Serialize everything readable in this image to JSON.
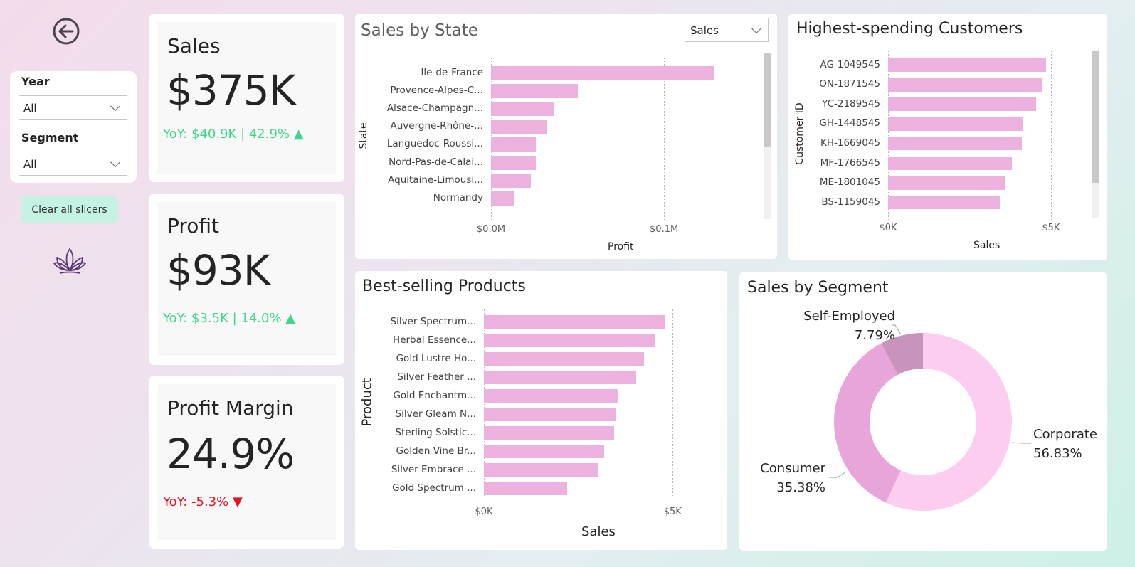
{
  "nav": {
    "back_icon": "back-arrow-icon",
    "logo_icon": "lotus-logo-icon"
  },
  "slicers": {
    "year": {
      "label": "Year",
      "value": "All"
    },
    "segment": {
      "label": "Segment",
      "value": "All"
    },
    "clear_label": "Clear all slicers"
  },
  "kpis": {
    "sales": {
      "title": "Sales",
      "value": "$375K",
      "yoy": "YoY: $40.9K | 42.9% ▲",
      "yoy_color": "#3dd68c"
    },
    "profit": {
      "title": "Profit",
      "value": "$93K",
      "yoy": "YoY: $3.5K | 14.0% ▲",
      "yoy_color": "#3dd68c"
    },
    "margin": {
      "title": "Profit Margin",
      "value": "24.9%",
      "yoy": "YoY: -5.3% ▼",
      "yoy_color": "#e81123"
    }
  },
  "colors": {
    "bar": "#ecb1de",
    "corporate": "#fccdef",
    "consumer": "#e7a5d9",
    "self_employed": "#c894bd"
  },
  "sales_by_state": {
    "title": "Sales by State",
    "metric_selector": "Sales",
    "chart_data": {
      "type": "bar",
      "title": "Sales by State",
      "xlabel": "Profit",
      "ylabel": "State",
      "categories": [
        "Ile-de-France",
        "Provence-Alpes-C...",
        "Alsace-Champagn...",
        "Auvergne-Rhône-...",
        "Languedoc-Roussi...",
        "Nord-Pas-de-Calai...",
        "Aquitaine-Limousi...",
        "Normandy"
      ],
      "values": [
        0.129,
        0.05,
        0.036,
        0.032,
        0.026,
        0.026,
        0.023,
        0.013
      ],
      "xlim": [
        0,
        0.16
      ],
      "ticks": [
        0,
        0.1
      ],
      "tick_labels": [
        "$0.0M",
        "$0.1M"
      ]
    }
  },
  "top_customers": {
    "title": "Highest-spending Customers",
    "chart_data": {
      "type": "bar",
      "title": "Highest-spending Customers",
      "xlabel": "Sales",
      "ylabel": "Customer ID",
      "categories": [
        "AG-1049545",
        "ON-1871545",
        "YC-2189545",
        "GH-1448545",
        "KH-1669045",
        "MF-1766545",
        "ME-1801045",
        "BS-1159045"
      ],
      "values": [
        4850,
        4720,
        4550,
        4120,
        4100,
        3800,
        3600,
        3430
      ],
      "xlim": [
        0,
        6400
      ],
      "ticks": [
        0,
        5000
      ],
      "tick_labels": [
        "$0K",
        "$5K"
      ]
    }
  },
  "best_products": {
    "title": "Best-selling Products",
    "chart_data": {
      "type": "bar",
      "title": "Best-selling Products",
      "xlabel": "Sales",
      "ylabel": "Product",
      "categories": [
        "Silver Spectrum...",
        "Herbal Essence...",
        "Gold Lustre Ho...",
        "Silver Feather ...",
        "Gold Enchantm...",
        "Silver Gleam N...",
        "Sterling Solstic...",
        "Golden Vine Br...",
        "Silver Embrace ...",
        "Gold Spectrum ..."
      ],
      "values": [
        4800,
        4530,
        4250,
        4030,
        3550,
        3480,
        3450,
        3180,
        3040,
        2210
      ],
      "xlim": [
        0,
        5900
      ],
      "ticks": [
        0,
        5000
      ],
      "tick_labels": [
        "$0K",
        "$5K"
      ]
    }
  },
  "segments": {
    "title": "Sales by Segment",
    "chart_data": {
      "type": "pie",
      "title": "Sales by Segment",
      "categories": [
        "Corporate",
        "Consumer",
        "Self-Employed"
      ],
      "values": [
        56.83,
        35.38,
        7.79
      ],
      "value_labels": [
        "56.83%",
        "35.38%",
        "7.79%"
      ]
    }
  }
}
